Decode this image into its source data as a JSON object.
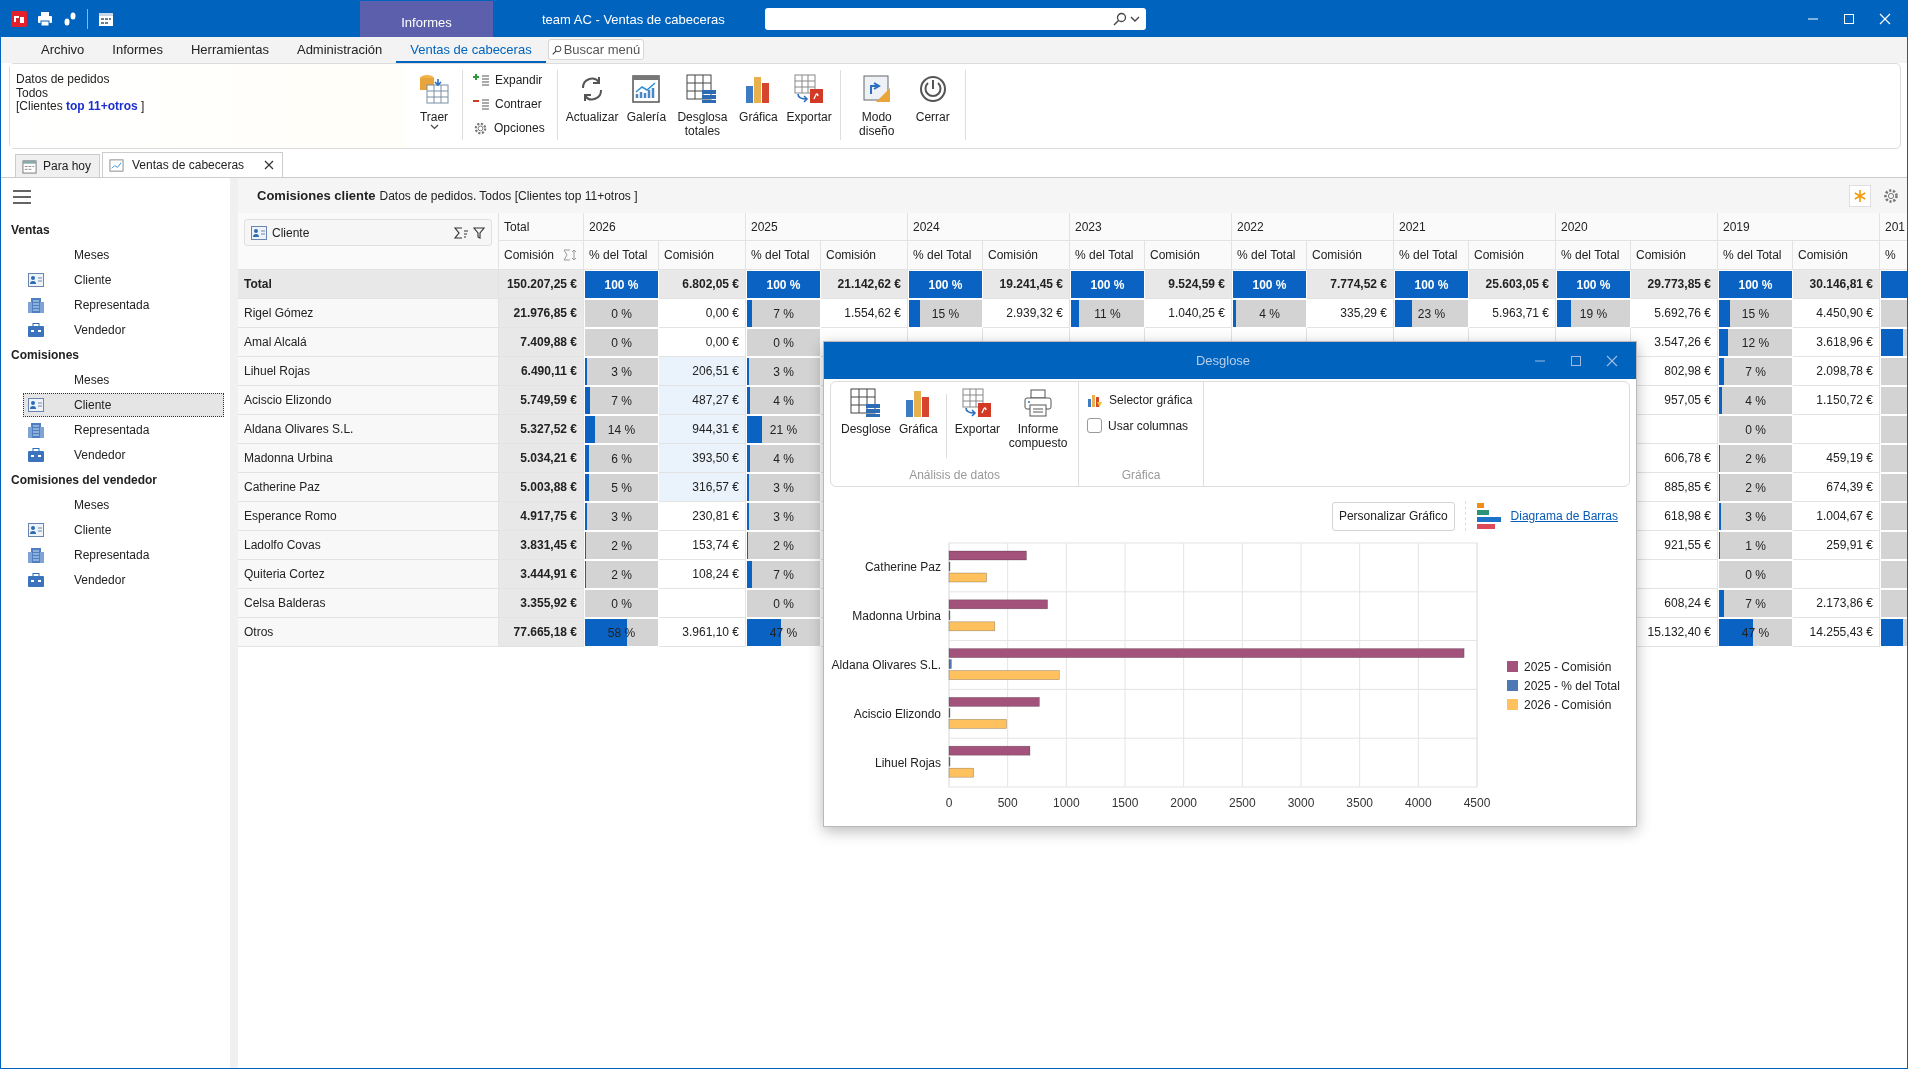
{
  "window": {
    "title": "team AC - Ventas de cabeceras",
    "context_tab": "Informes"
  },
  "menu": {
    "items": [
      {
        "label": "Archivo",
        "selected": false
      },
      {
        "label": "Informes",
        "selected": false
      },
      {
        "label": "Herramientas",
        "selected": false
      },
      {
        "label": "Administración",
        "selected": false
      },
      {
        "label": "Ventas de cabeceras",
        "selected": true
      }
    ],
    "search": {
      "placeholder": "Buscar menú"
    }
  },
  "ribbon": {
    "info": [
      "Datos de pedidos",
      "Todos",
      "[Clientes **top 11+otros** ]"
    ],
    "groups": [
      {
        "kind": "large",
        "buttons": [
          {
            "label": "Traer",
            "dropdown": true
          }
        ]
      },
      {
        "kind": "small",
        "buttons": [
          {
            "label": "Expandir"
          },
          {
            "label": "Contraer"
          },
          {
            "label": "Opciones"
          }
        ]
      },
      {
        "kind": "large",
        "buttons": [
          {
            "label": "Actualizar",
            "dropdown": false
          },
          {
            "label": "Galería",
            "dropdown": false
          },
          {
            "label": "Desglosa totales",
            "dropdown": false
          },
          {
            "label": "Gráfica",
            "dropdown": false
          },
          {
            "label": "Exportar",
            "dropdown": false
          }
        ]
      },
      {
        "kind": "large",
        "buttons": [
          {
            "label": "Modo diseño",
            "dropdown": false
          },
          {
            "label": "Cerrar",
            "dropdown": false
          }
        ]
      }
    ]
  },
  "doc_tabs": [
    {
      "label": "Para hoy",
      "selected": false,
      "closable": false
    },
    {
      "label": "Ventas de cabeceras",
      "selected": true,
      "closable": true
    }
  ],
  "sidebar": {
    "sections": [
      {
        "title": "Ventas",
        "items": [
          {
            "label": "Meses",
            "kind": "plain",
            "selected": false
          },
          {
            "label": "Cliente",
            "kind": "card",
            "selected": false
          },
          {
            "label": "Representada",
            "kind": "building",
            "selected": false
          },
          {
            "label": "Vendedor",
            "kind": "case",
            "selected": false
          }
        ]
      },
      {
        "title": "Comisiones",
        "items": [
          {
            "label": "Meses",
            "kind": "plain",
            "selected": false
          },
          {
            "label": "Cliente",
            "kind": "card",
            "selected": true
          },
          {
            "label": "Representada",
            "kind": "building",
            "selected": false
          },
          {
            "label": "Vendedor",
            "kind": "case",
            "selected": false
          }
        ]
      },
      {
        "title": "Comisiones del vendedor",
        "items": [
          {
            "label": "Meses",
            "kind": "plain",
            "selected": false
          },
          {
            "label": "Cliente",
            "kind": "card",
            "selected": false
          },
          {
            "label": "Representada",
            "kind": "building",
            "selected": false
          },
          {
            "label": "Vendedor",
            "kind": "case",
            "selected": false
          }
        ]
      }
    ]
  },
  "report": {
    "title": "Comisiones cliente",
    "subtitle": "Datos de pedidos. Todos [Clientes top 11+otros ]"
  },
  "table": {
    "row_header": "Cliente",
    "total_header": "Total",
    "total_column": "Comisión",
    "years": [
      {
        "label": "2026",
        "columns": [
          "% del Total",
          "Comisión"
        ]
      },
      {
        "label": "2025",
        "columns": [
          "% del Total",
          "Comisión"
        ]
      },
      {
        "label": "2024",
        "columns": [
          "% del Total",
          "Comisión"
        ]
      },
      {
        "label": "2023",
        "columns": [
          "% del Total",
          "Comisión"
        ]
      },
      {
        "label": "2022",
        "columns": [
          "% del Total",
          "Comisión"
        ]
      },
      {
        "label": "2021",
        "columns": [
          "% del Total",
          "Comisión"
        ]
      },
      {
        "label": "2020",
        "columns": [
          "% del Total",
          "Comisión"
        ]
      },
      {
        "label": "2019",
        "columns": [
          "% del Total",
          "Comisión"
        ]
      },
      {
        "label": "201",
        "columns": [
          "%"
        ]
      }
    ],
    "rows": [
      {
        "label": "Total",
        "kind": "total",
        "total": "150.207,25 €",
        "cells": [
          {
            "kind": "pct",
            "text": "100 %",
            "level": 1
          },
          {
            "kind": "money",
            "text": "6.802,05 €",
            "selected": false
          },
          {
            "kind": "pct",
            "text": "100 %",
            "level": 1
          },
          {
            "kind": "money",
            "text": "21.142,62 €",
            "selected": false
          },
          {
            "kind": "pct",
            "text": "100 %",
            "level": 1
          },
          {
            "kind": "money",
            "text": "19.241,45 €",
            "selected": false
          },
          {
            "kind": "pct",
            "text": "100 %",
            "level": 1
          },
          {
            "kind": "money",
            "text": "9.524,59 €",
            "selected": false
          },
          {
            "kind": "pct",
            "text": "100 %",
            "level": 1
          },
          {
            "kind": "money",
            "text": "7.774,52 €",
            "selected": false
          },
          {
            "kind": "pct",
            "text": "100 %",
            "level": 1
          },
          {
            "kind": "money",
            "text": "25.603,05 €",
            "selected": false
          },
          {
            "kind": "pct",
            "text": "100 %",
            "level": 1
          },
          {
            "kind": "money",
            "text": "29.773,85 €",
            "selected": false
          },
          {
            "kind": "pct",
            "text": "100 %",
            "level": 1
          },
          {
            "kind": "money",
            "text": "30.146,81 €",
            "selected": false
          },
          {
            "kind": "pct",
            "level": 1
          }
        ]
      },
      {
        "label": "Rigel Gómez",
        "kind": "item",
        "total": "21.976,85 €",
        "cells": [
          {
            "kind": "pct",
            "text": "0 %",
            "level": 0
          },
          {
            "kind": "money",
            "text": "0,00 €",
            "selected": false
          },
          {
            "kind": "pct",
            "text": "7 %",
            "level": 0.07
          },
          {
            "kind": "money",
            "text": "1.554,62 €",
            "selected": false
          },
          {
            "kind": "pct",
            "text": "15 %",
            "level": 0.15
          },
          {
            "kind": "money",
            "text": "2.939,32 €",
            "selected": false
          },
          {
            "kind": "pct",
            "text": "11 %",
            "level": 0.11
          },
          {
            "kind": "money",
            "text": "1.040,25 €",
            "selected": false
          },
          {
            "kind": "pct",
            "text": "4 %",
            "level": 0.04
          },
          {
            "kind": "money",
            "text": "335,29 €",
            "selected": false
          },
          {
            "kind": "pct",
            "text": "23 %",
            "level": 0.23
          },
          {
            "kind": "money",
            "text": "5.963,71 €",
            "selected": false
          },
          {
            "kind": "pct",
            "text": "19 %",
            "level": 0.19
          },
          {
            "kind": "money",
            "text": "5.692,76 €",
            "selected": false
          },
          {
            "kind": "pct",
            "text": "15 %",
            "level": 0.15
          },
          {
            "kind": "money",
            "text": "4.450,90 €",
            "selected": false
          },
          {
            "kind": "pct",
            "level": 0
          }
        ]
      },
      {
        "label": "Amal Alcalá",
        "kind": "item",
        "total": "7.409,88 €",
        "cells": [
          {
            "kind": "pct",
            "text": "0 %",
            "level": 0
          },
          {
            "kind": "money",
            "text": "0,00 €",
            "selected": false
          },
          {
            "kind": "pct",
            "text": "0 %",
            "level": 0
          },
          {
            "kind": "hidden"
          },
          {
            "kind": "hidden"
          },
          {
            "kind": "hidden"
          },
          {
            "kind": "hidden"
          },
          {
            "kind": "hidden"
          },
          {
            "kind": "hidden"
          },
          {
            "kind": "hidden"
          },
          {
            "kind": "hidden"
          },
          {
            "kind": "hidden"
          },
          {
            "kind": "hidden"
          },
          {
            "kind": "money",
            "text": "3.547,26 €",
            "selected": false
          },
          {
            "kind": "pct",
            "text": "12 %",
            "level": 0.12
          },
          {
            "kind": "money",
            "text": "3.618,96 €",
            "selected": false
          },
          {
            "kind": "pct",
            "level": 0.3
          }
        ]
      },
      {
        "label": "Lihuel Rojas",
        "kind": "item",
        "total": "6.490,11 €",
        "cells": [
          {
            "kind": "pct",
            "text": "3 %",
            "level": 0.03
          },
          {
            "kind": "money",
            "text": "206,51 €",
            "selected": true
          },
          {
            "kind": "pct",
            "text": "3 %",
            "level": 0.03
          },
          {
            "kind": "hidden"
          },
          {
            "kind": "hidden"
          },
          {
            "kind": "hidden"
          },
          {
            "kind": "hidden"
          },
          {
            "kind": "hidden"
          },
          {
            "kind": "hidden"
          },
          {
            "kind": "hidden"
          },
          {
            "kind": "hidden"
          },
          {
            "kind": "hidden"
          },
          {
            "kind": "hidden"
          },
          {
            "kind": "money",
            "text": "802,98 €",
            "selected": false
          },
          {
            "kind": "pct",
            "text": "7 %",
            "level": 0.07
          },
          {
            "kind": "money",
            "text": "2.098,78 €",
            "selected": false
          },
          {
            "kind": "pct",
            "level": 0
          }
        ]
      },
      {
        "label": "Aciscio Elizondo",
        "kind": "item",
        "total": "5.749,59 €",
        "cells": [
          {
            "kind": "pct",
            "text": "7 %",
            "level": 0.07
          },
          {
            "kind": "money",
            "text": "487,27 €",
            "selected": true
          },
          {
            "kind": "pct",
            "text": "4 %",
            "level": 0.04
          },
          {
            "kind": "hidden"
          },
          {
            "kind": "hidden"
          },
          {
            "kind": "hidden"
          },
          {
            "kind": "hidden"
          },
          {
            "kind": "hidden"
          },
          {
            "kind": "hidden"
          },
          {
            "kind": "hidden"
          },
          {
            "kind": "hidden"
          },
          {
            "kind": "hidden"
          },
          {
            "kind": "hidden"
          },
          {
            "kind": "money",
            "text": "957,05 €",
            "selected": false
          },
          {
            "kind": "pct",
            "text": "4 %",
            "level": 0.04
          },
          {
            "kind": "money",
            "text": "1.150,72 €",
            "selected": false
          },
          {
            "kind": "pct",
            "level": 0
          }
        ]
      },
      {
        "label": "Aldana Olivares S.L.",
        "kind": "item",
        "total": "5.327,52 €",
        "cells": [
          {
            "kind": "pct",
            "text": "14 %",
            "level": 0.14
          },
          {
            "kind": "money",
            "text": "944,31 €",
            "selected": true
          },
          {
            "kind": "pct",
            "text": "21 %",
            "level": 0.21
          },
          {
            "kind": "hidden"
          },
          {
            "kind": "hidden"
          },
          {
            "kind": "hidden"
          },
          {
            "kind": "hidden"
          },
          {
            "kind": "hidden"
          },
          {
            "kind": "hidden"
          },
          {
            "kind": "hidden"
          },
          {
            "kind": "hidden"
          },
          {
            "kind": "hidden"
          },
          {
            "kind": "hidden"
          },
          {
            "kind": "money",
            "selected": false
          },
          {
            "kind": "pct",
            "text": "0 %",
            "level": 0
          },
          {
            "kind": "money",
            "selected": false
          },
          {
            "kind": "pct",
            "level": 0
          }
        ]
      },
      {
        "label": "Madonna Urbina",
        "kind": "item",
        "total": "5.034,21 €",
        "cells": [
          {
            "kind": "pct",
            "text": "6 %",
            "level": 0.06
          },
          {
            "kind": "money",
            "text": "393,50 €",
            "selected": true
          },
          {
            "kind": "pct",
            "text": "4 %",
            "level": 0.04
          },
          {
            "kind": "hidden"
          },
          {
            "kind": "hidden"
          },
          {
            "kind": "hidden"
          },
          {
            "kind": "hidden"
          },
          {
            "kind": "hidden"
          },
          {
            "kind": "hidden"
          },
          {
            "kind": "hidden"
          },
          {
            "kind": "hidden"
          },
          {
            "kind": "hidden"
          },
          {
            "kind": "hidden"
          },
          {
            "kind": "money",
            "text": "606,78 €",
            "selected": false
          },
          {
            "kind": "pct",
            "text": "2 %",
            "level": 0.02
          },
          {
            "kind": "money",
            "text": "459,19 €",
            "selected": false
          },
          {
            "kind": "pct",
            "level": 0
          }
        ]
      },
      {
        "label": "Catherine Paz",
        "kind": "item",
        "total": "5.003,88 €",
        "cells": [
          {
            "kind": "pct",
            "text": "5 %",
            "level": 0.05
          },
          {
            "kind": "money",
            "text": "316,57 €",
            "selected": true
          },
          {
            "kind": "pct",
            "text": "3 %",
            "level": 0.03
          },
          {
            "kind": "hidden"
          },
          {
            "kind": "hidden"
          },
          {
            "kind": "hidden"
          },
          {
            "kind": "hidden"
          },
          {
            "kind": "hidden"
          },
          {
            "kind": "hidden"
          },
          {
            "kind": "hidden"
          },
          {
            "kind": "hidden"
          },
          {
            "kind": "hidden"
          },
          {
            "kind": "hidden"
          },
          {
            "kind": "money",
            "text": "885,85 €",
            "selected": false
          },
          {
            "kind": "pct",
            "text": "2 %",
            "level": 0.02
          },
          {
            "kind": "money",
            "text": "674,39 €",
            "selected": false
          },
          {
            "kind": "pct",
            "level": 0
          }
        ]
      },
      {
        "label": "Esperance Romo",
        "kind": "item",
        "total": "4.917,75 €",
        "cells": [
          {
            "kind": "pct",
            "text": "3 %",
            "level": 0.03
          },
          {
            "kind": "money",
            "text": "230,81 €",
            "selected": false
          },
          {
            "kind": "pct",
            "text": "3 %",
            "level": 0.03
          },
          {
            "kind": "hidden"
          },
          {
            "kind": "hidden"
          },
          {
            "kind": "hidden"
          },
          {
            "kind": "hidden"
          },
          {
            "kind": "hidden"
          },
          {
            "kind": "hidden"
          },
          {
            "kind": "hidden"
          },
          {
            "kind": "hidden"
          },
          {
            "kind": "hidden"
          },
          {
            "kind": "hidden"
          },
          {
            "kind": "money",
            "text": "618,98 €",
            "selected": false
          },
          {
            "kind": "pct",
            "text": "3 %",
            "level": 0.03
          },
          {
            "kind": "money",
            "text": "1.004,67 €",
            "selected": false
          },
          {
            "kind": "pct",
            "level": 0
          }
        ]
      },
      {
        "label": "Ladolfo Covas",
        "kind": "item",
        "total": "3.831,45 €",
        "cells": [
          {
            "kind": "pct",
            "text": "2 %",
            "level": 0.02
          },
          {
            "kind": "money",
            "text": "153,74 €",
            "selected": false
          },
          {
            "kind": "pct",
            "text": "2 %",
            "level": 0.02
          },
          {
            "kind": "hidden"
          },
          {
            "kind": "hidden"
          },
          {
            "kind": "hidden"
          },
          {
            "kind": "hidden"
          },
          {
            "kind": "hidden"
          },
          {
            "kind": "hidden"
          },
          {
            "kind": "hidden"
          },
          {
            "kind": "hidden"
          },
          {
            "kind": "hidden"
          },
          {
            "kind": "hidden"
          },
          {
            "kind": "money",
            "text": "921,55 €",
            "selected": false
          },
          {
            "kind": "pct",
            "text": "1 %",
            "level": 0.01
          },
          {
            "kind": "money",
            "text": "259,91 €",
            "selected": false
          },
          {
            "kind": "pct",
            "level": 0
          }
        ]
      },
      {
        "label": "Quiteria Cortez",
        "kind": "item",
        "total": "3.444,91 €",
        "cells": [
          {
            "kind": "pct",
            "text": "2 %",
            "level": 0.02
          },
          {
            "kind": "money",
            "text": "108,24 €",
            "selected": false
          },
          {
            "kind": "pct",
            "text": "7 %",
            "level": 0.07
          },
          {
            "kind": "hidden"
          },
          {
            "kind": "hidden"
          },
          {
            "kind": "hidden"
          },
          {
            "kind": "hidden"
          },
          {
            "kind": "hidden"
          },
          {
            "kind": "hidden"
          },
          {
            "kind": "hidden"
          },
          {
            "kind": "hidden"
          },
          {
            "kind": "hidden"
          },
          {
            "kind": "hidden"
          },
          {
            "kind": "money",
            "selected": false
          },
          {
            "kind": "pct",
            "text": "0 %",
            "level": 0
          },
          {
            "kind": "money",
            "selected": false
          },
          {
            "kind": "pct",
            "level": 0
          }
        ]
      },
      {
        "label": "Celsa Balderas",
        "kind": "item",
        "total": "3.355,92 €",
        "cells": [
          {
            "kind": "pct",
            "text": "0 %",
            "level": 0
          },
          {
            "kind": "money",
            "selected": false
          },
          {
            "kind": "pct",
            "text": "0 %",
            "level": 0
          },
          {
            "kind": "hidden"
          },
          {
            "kind": "hidden"
          },
          {
            "kind": "hidden"
          },
          {
            "kind": "hidden"
          },
          {
            "kind": "hidden"
          },
          {
            "kind": "hidden"
          },
          {
            "kind": "hidden"
          },
          {
            "kind": "hidden"
          },
          {
            "kind": "hidden"
          },
          {
            "kind": "hidden"
          },
          {
            "kind": "money",
            "text": "608,24 €",
            "selected": false
          },
          {
            "kind": "pct",
            "text": "7 %",
            "level": 0.07
          },
          {
            "kind": "money",
            "text": "2.173,86 €",
            "selected": false
          },
          {
            "kind": "pct",
            "level": 0
          }
        ]
      },
      {
        "label": "Otros",
        "kind": "item",
        "total": "77.665,18 €",
        "cells": [
          {
            "kind": "pct",
            "text": "58 %",
            "level": 0.58
          },
          {
            "kind": "money",
            "text": "3.961,10 €",
            "selected": false
          },
          {
            "kind": "pct",
            "text": "47 %",
            "level": 0.47
          },
          {
            "kind": "hidden"
          },
          {
            "kind": "hidden"
          },
          {
            "kind": "hidden"
          },
          {
            "kind": "hidden"
          },
          {
            "kind": "hidden"
          },
          {
            "kind": "hidden"
          },
          {
            "kind": "hidden"
          },
          {
            "kind": "hidden"
          },
          {
            "kind": "hidden"
          },
          {
            "kind": "hidden"
          },
          {
            "kind": "money",
            "text": "15.132,40 €",
            "selected": false
          },
          {
            "kind": "pct",
            "text": "47 %",
            "level": 0.47
          },
          {
            "kind": "money",
            "text": "14.255,43 €",
            "selected": false
          },
          {
            "kind": "pct",
            "level": 0.3
          }
        ]
      }
    ]
  },
  "dialog": {
    "title": "Desglose",
    "analysis_group": {
      "label": "Análisis de datos",
      "buttons": [
        "Desglose",
        "Gráfica",
        "Exportar",
        "Informe compuesto"
      ]
    },
    "chart_group": {
      "label": "Gráfica",
      "selector": "Selector gráfica",
      "checkbox": {
        "label": "Usar columnas",
        "checked": false
      }
    },
    "customize_button": "Personalizar Gráfico",
    "chart_type_link": "Diagrama de Barras",
    "chart_data": {
      "type": "bar",
      "orientation": "horizontal",
      "categories": [
        "Catherine Paz",
        "Madonna Urbina",
        "Aldana Olivares S.L.",
        "Aciscio Elizondo",
        "Lihuel Rojas"
      ],
      "series": [
        {
          "name": "2025 - Comisión",
          "color": "#a3527b",
          "values": [
            660,
            840,
            4390,
            770,
            690
          ]
        },
        {
          "name": "2025 - % del Total",
          "color": "#4f79b5",
          "values": [
            0,
            0,
            20,
            0,
            0
          ]
        },
        {
          "name": "2026 - Comisión",
          "color": "#ffc15e",
          "values": [
            320,
            390,
            940,
            490,
            210
          ]
        }
      ],
      "grid": true,
      "legend": "right",
      "xlim": [
        0,
        4500
      ],
      "xticks": [
        0,
        500,
        1000,
        1500,
        2000,
        2500,
        3000,
        3500,
        4000,
        4500
      ]
    }
  }
}
